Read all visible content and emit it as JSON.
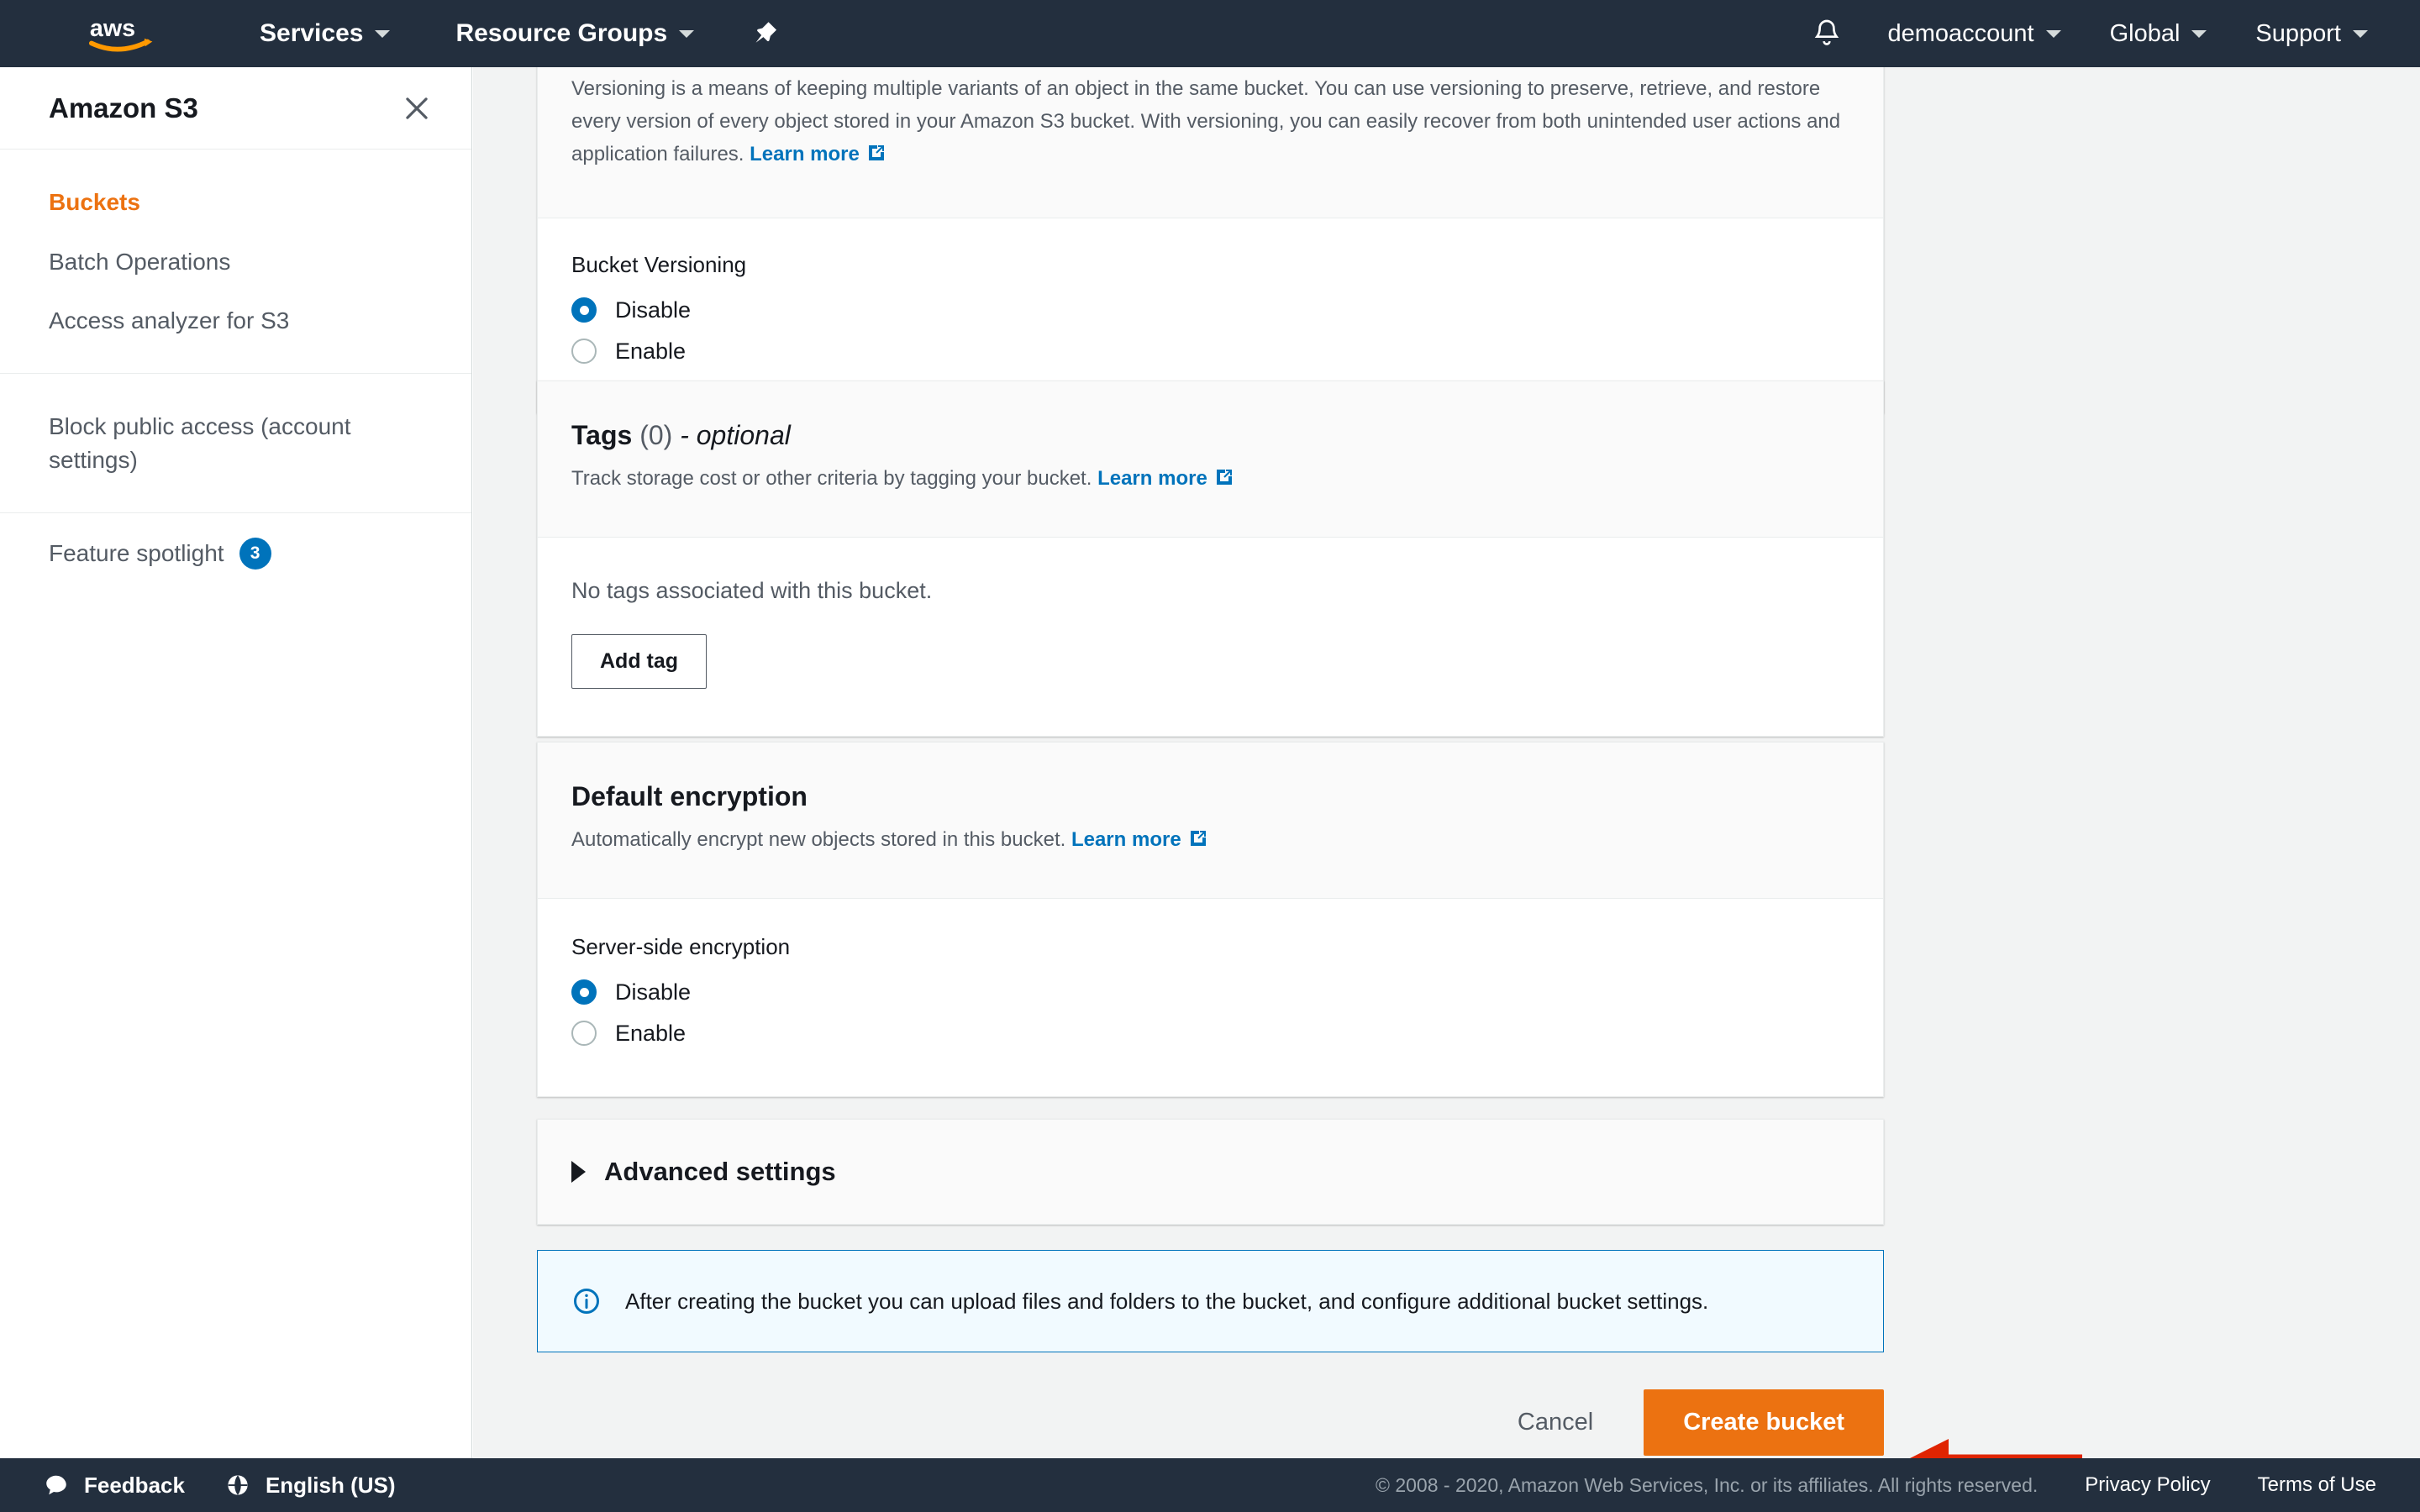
{
  "topnav": {
    "logo_alt": "aws",
    "services_label": "Services",
    "resource_groups_label": "Resource Groups",
    "pin_icon": "pushpin-icon",
    "bell_icon": "notifications-bell-icon",
    "account_label": "demoaccount",
    "region_label": "Global",
    "support_label": "Support"
  },
  "sidebar": {
    "title": "Amazon S3",
    "close_icon": "close-icon",
    "groups": [
      {
        "items": [
          {
            "label": "Buckets",
            "active": true
          },
          {
            "label": "Batch Operations",
            "active": false
          },
          {
            "label": "Access analyzer for S3",
            "active": false
          }
        ]
      },
      {
        "items": [
          {
            "label": "Block public access (account settings)",
            "active": false
          }
        ]
      }
    ],
    "spotlight": {
      "label": "Feature spotlight",
      "badge": "3"
    }
  },
  "main": {
    "versioning": {
      "description": "Versioning is a means of keeping multiple variants of an object in the same bucket. You can use versioning to preserve, retrieve, and restore every version of every object stored in your Amazon S3 bucket. With versioning, you can easily recover from both unintended user actions and application failures.",
      "learn_more": "Learn more",
      "field_label": "Bucket Versioning",
      "options": [
        {
          "label": "Disable",
          "checked": true
        },
        {
          "label": "Enable",
          "checked": false
        }
      ]
    },
    "tags": {
      "title": "Tags",
      "count": "(0)",
      "optional_suffix": "- optional",
      "description": "Track storage cost or other criteria by tagging your bucket.",
      "learn_more": "Learn more",
      "empty_text": "No tags associated with this bucket.",
      "add_tag_label": "Add tag"
    },
    "encryption": {
      "title": "Default encryption",
      "description": "Automatically encrypt new objects stored in this bucket.",
      "learn_more": "Learn more",
      "field_label": "Server-side encryption",
      "options": [
        {
          "label": "Disable",
          "checked": true
        },
        {
          "label": "Enable",
          "checked": false
        }
      ]
    },
    "advanced": {
      "label": "Advanced settings",
      "expanded": false
    },
    "info_banner": {
      "icon": "info-circle-icon",
      "text": "After creating the bucket you can upload files and folders to the bucket, and configure additional bucket settings."
    },
    "actions": {
      "cancel_label": "Cancel",
      "create_label": "Create bucket"
    },
    "annotation": {
      "type": "arrow",
      "color": "#e02401",
      "points_to": "create-bucket-button"
    }
  },
  "footer": {
    "feedback_label": "Feedback",
    "feedback_icon": "speech-bubble-icon",
    "language_label": "English (US)",
    "language_icon": "globe-icon",
    "copyright": "© 2008 - 2020, Amazon Web Services, Inc. or its affiliates. All rights reserved.",
    "privacy_label": "Privacy Policy",
    "terms_label": "Terms of Use"
  },
  "colors": {
    "nav_bg": "#232f3e",
    "accent_orange": "#ec7211",
    "link_blue": "#0073bb",
    "page_bg": "#f2f3f3",
    "annotation_red": "#e02401"
  }
}
